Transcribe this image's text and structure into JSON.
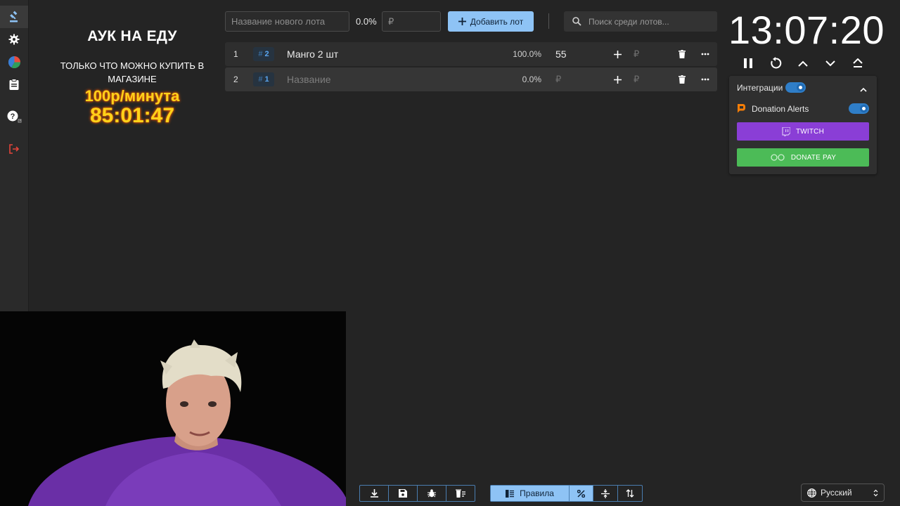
{
  "sidebar": {
    "items": [
      {
        "icon": "gavel-icon",
        "active": true
      },
      {
        "icon": "gear-icon"
      },
      {
        "icon": "pie-chart-icon"
      },
      {
        "icon": "clipboard-icon"
      },
      {
        "icon": "help-icon"
      },
      {
        "icon": "logout-icon"
      }
    ]
  },
  "auction": {
    "title": "АУК НА ЕДУ",
    "note": "ТОЛЬКО ЧТО МОЖНО КУПИТЬ В МАГАЗИНЕ",
    "rate": "100р/минута",
    "countdown": "85:01:47"
  },
  "toolbar": {
    "new_lot_placeholder": "Название нового лота",
    "percent": "0.0%",
    "amount_placeholder": "₽",
    "add_label": "Добавить лот",
    "search_placeholder": "Поиск среди лотов..."
  },
  "lots": [
    {
      "index": "1",
      "tag": "2",
      "name": "Манго 2 шт",
      "percent": "100.0%",
      "amount": "55",
      "add_placeholder": "₽"
    },
    {
      "index": "2",
      "tag": "1",
      "name_placeholder": "Название",
      "percent": "0.0%",
      "amount_placeholder": "₽",
      "add_placeholder": "₽"
    }
  ],
  "timer": {
    "value": "13:07:20"
  },
  "integrations": {
    "label": "Интеграции",
    "enabled": true,
    "donation_alerts": {
      "label": "Donation Alerts",
      "enabled": true
    },
    "twitch_label": "TWITCH",
    "donatepay_label": "DONATE PAY"
  },
  "bottom": {
    "rules_label": "Правила"
  },
  "language": {
    "selected": "Русский"
  },
  "colors": {
    "accent": "#8ec3f5",
    "twitch": "#8a3ed6",
    "donatepay": "#4cbb57",
    "gold": "#ffd21a"
  }
}
